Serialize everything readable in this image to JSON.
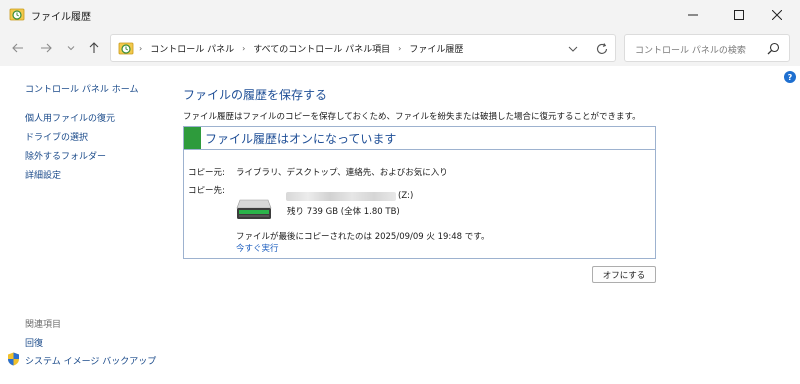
{
  "window": {
    "title": "ファイル履歴"
  },
  "address": {
    "crumbs": [
      "コントロール パネル",
      "すべてのコントロール パネル項目",
      "ファイル履歴"
    ]
  },
  "search": {
    "placeholder": "コントロール パネルの検索"
  },
  "sidebar": {
    "home": "コントロール パネル ホーム",
    "links": [
      "個人用ファイルの復元",
      "ドライブの選択",
      "除外するフォルダー",
      "詳細設定"
    ],
    "related_heading": "関連項目",
    "related": [
      "回復",
      "システム イメージ バックアップ"
    ]
  },
  "main": {
    "title": "ファイルの履歴を保存する",
    "description": "ファイル履歴はファイルのコピーを保存しておくため、ファイルを紛失または破損した場合に復元することができます。",
    "status_title": "ファイル履歴はオンになっています",
    "copy_from_label": "コピー元:",
    "copy_from_value": "ライブラリ、デスクトップ、連絡先、およびお気に入り",
    "copy_to_label": "コピー先:",
    "drive_letter": "(Z:)",
    "free_space": "残り 739 GB (全体 1.80 TB)",
    "last_copy": "ファイルが最後にコピーされたのは 2025/09/09 火 19:48 です。",
    "run_now": "今すぐ実行",
    "turn_off": "オフにする"
  },
  "colors": {
    "link": "#1a4a8a",
    "heading": "#1e4e96",
    "status_green": "#2e9b3c"
  }
}
